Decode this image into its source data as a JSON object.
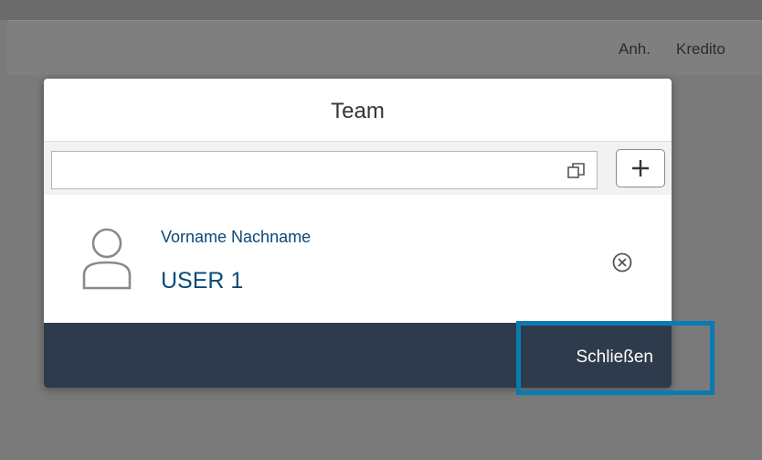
{
  "background": {
    "columns": [
      "Anh.",
      "Kredito"
    ]
  },
  "dialog": {
    "title": "Team",
    "search": {
      "value": "",
      "placeholder": ""
    },
    "add_icon": "plus-icon",
    "value_help_icon": "value-help-icon",
    "members": [
      {
        "name": "Vorname Nachname",
        "user": "USER 1",
        "avatar_icon": "person-icon",
        "remove_icon": "remove-circle-icon"
      }
    ],
    "footer": {
      "close_label": "Schließen"
    }
  },
  "colors": {
    "footer_bg": "#2e3b4c",
    "highlight": "#0a7bb0",
    "member_text": "#0a4a7a"
  }
}
